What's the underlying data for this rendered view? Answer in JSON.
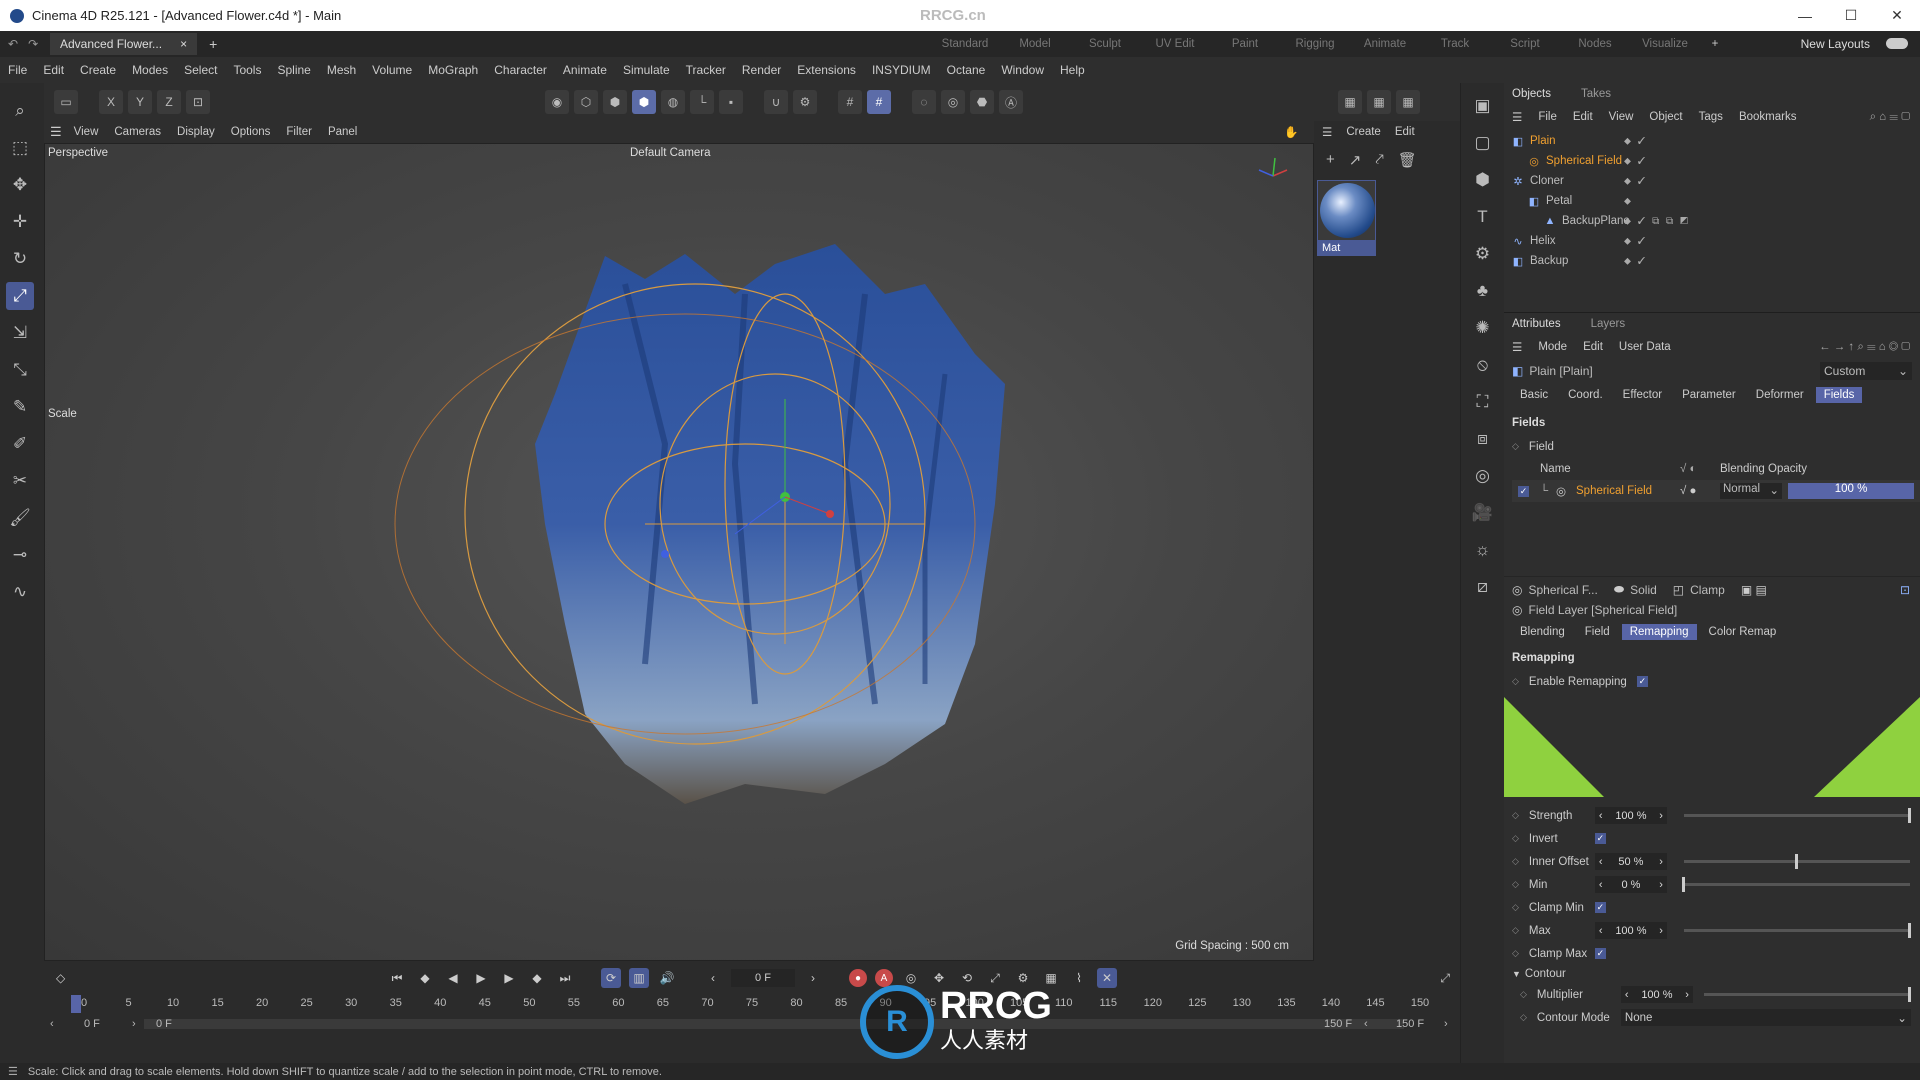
{
  "title": "Cinema 4D R25.121 - [Advanced Flower.c4d *] - Main",
  "watermark": "RRCG.cn",
  "window_controls": [
    "—",
    "☐",
    "✕"
  ],
  "doc_tab": "Advanced Flower...",
  "layouts": [
    "Standard",
    "Model",
    "Sculpt",
    "UV Edit",
    "Paint",
    "Rigging",
    "Animate",
    "Track",
    "Script",
    "Nodes",
    "Visualize"
  ],
  "new_layouts": "New Layouts",
  "menu": [
    "File",
    "Edit",
    "Create",
    "Modes",
    "Select",
    "Tools",
    "Spline",
    "Mesh",
    "Volume",
    "MoGraph",
    "Character",
    "Animate",
    "Simulate",
    "Tracker",
    "Render",
    "Extensions",
    "INSYDIUM",
    "Octane",
    "Window",
    "Help"
  ],
  "axis_buttons": [
    "X",
    "Y",
    "Z"
  ],
  "viewport_menu": [
    "View",
    "Cameras",
    "Display",
    "Options",
    "Filter",
    "Panel"
  ],
  "viewport": {
    "projection": "Perspective",
    "camera": "Default Camera",
    "tool_label": "Scale",
    "grid_spacing": "Grid Spacing : 500 cm"
  },
  "side_menu": [
    "Create",
    "Edit"
  ],
  "material": {
    "name": "Mat"
  },
  "objects_panel": {
    "tabs": [
      "Objects",
      "Takes"
    ],
    "menu": [
      "File",
      "Edit",
      "View",
      "Object",
      "Tags",
      "Bookmarks"
    ],
    "items": [
      {
        "name": "Plain",
        "indent": 0,
        "highlight": true
      },
      {
        "name": "Spherical Field",
        "indent": 1,
        "highlight": true
      },
      {
        "name": "Cloner",
        "indent": 0,
        "highlight": false
      },
      {
        "name": "Petal",
        "indent": 1,
        "highlight": false
      },
      {
        "name": "BackupPlane",
        "indent": 2,
        "highlight": false
      },
      {
        "name": "Helix",
        "indent": 0,
        "highlight": false
      },
      {
        "name": "Backup",
        "indent": 0,
        "highlight": false
      }
    ]
  },
  "attributes": {
    "tabs": [
      "Attributes",
      "Layers"
    ],
    "menu": [
      "Mode",
      "Edit",
      "User Data"
    ],
    "object_label": "Plain [Plain]",
    "preset": "Custom",
    "tabs2": [
      "Basic",
      "Coord.",
      "Effector",
      "Parameter",
      "Deformer",
      "Fields"
    ],
    "active_tab": "Fields",
    "fields_section": "Fields",
    "field_label": "Field",
    "columns": [
      "Name",
      "Blending",
      "Opacity"
    ],
    "field_row": {
      "name": "Spherical Field",
      "blending": "Normal",
      "opacity": "100 %",
      "opacity_value": 100
    },
    "layer_bar": [
      "Spherical F...",
      "Solid",
      "Clamp"
    ],
    "layer_title": "Field Layer [Spherical Field]",
    "layer_tabs": [
      "Blending",
      "Field",
      "Remapping",
      "Color Remap"
    ],
    "active_layer_tab": "Remapping",
    "remap_section": "Remapping",
    "enable_remapping": "Enable Remapping",
    "strength": {
      "label": "Strength",
      "value": "100 %",
      "level": 100
    },
    "invert": "Invert",
    "inner_offset": {
      "label": "Inner Offset",
      "value": "50 %",
      "level": 50
    },
    "min": {
      "label": "Min",
      "value": "0 %",
      "level": 0
    },
    "clamp_min": "Clamp Min",
    "max": {
      "label": "Max",
      "value": "100 %",
      "level": 100
    },
    "clamp_max": "Clamp Max",
    "contour_section": "Contour",
    "multiplier": {
      "label": "Multiplier",
      "value": "100 %",
      "level": 100
    },
    "contour_mode": {
      "label": "Contour Mode",
      "value": "None"
    }
  },
  "timeline": {
    "current_frame": "0 F",
    "ticks": [
      "0",
      "5",
      "10",
      "15",
      "20",
      "25",
      "30",
      "35",
      "40",
      "45",
      "50",
      "55",
      "60",
      "65",
      "70",
      "75",
      "80",
      "85",
      "90",
      "95",
      "100",
      "105",
      "110",
      "115",
      "120",
      "125",
      "130",
      "135",
      "140",
      "145",
      "150"
    ],
    "range_start": "0 F",
    "range_start2": "0 F",
    "range_end": "150 F",
    "range_end2": "150 F"
  },
  "status_text": "Scale: Click and drag to scale elements. Hold down SHIFT to quantize scale / add to the selection in point mode, CTRL to remove.",
  "logo": {
    "letters": "RRCG",
    "sub": "人人素材"
  },
  "colors": {
    "accent": "#5865a8",
    "remap_graph": "#8fd13f",
    "field_name": "#f0a030"
  }
}
